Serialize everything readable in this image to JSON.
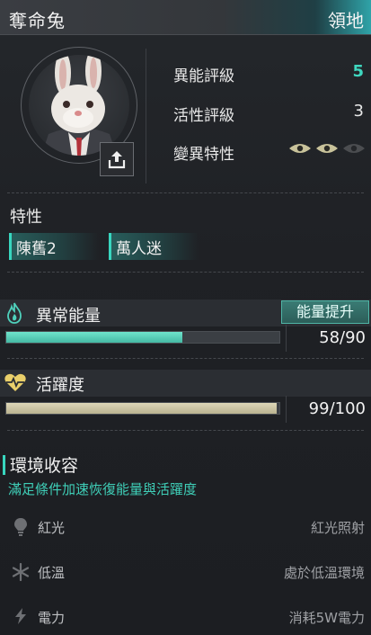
{
  "header": {
    "title": "奪命兔",
    "territory": "領地"
  },
  "ratings": [
    {
      "label": "異能評級",
      "value": "5",
      "color": "#3fd7bf"
    },
    {
      "label": "活性評級",
      "value": "3",
      "color": "#e8e8e8"
    },
    {
      "label": "變異特性",
      "eyes_active": 2,
      "eyes_total": 3
    }
  ],
  "traits": {
    "title": "特性",
    "items": [
      "陳舊2",
      "萬人迷"
    ]
  },
  "energy": {
    "label": "異常能量",
    "boost_label": "能量提升",
    "current": 58,
    "max": 90,
    "text": "58/90",
    "fill": 0.644,
    "color": "#5fd6bf"
  },
  "vigor": {
    "label": "活躍度",
    "current": 99,
    "max": 100,
    "text": "99/100",
    "fill": 0.99,
    "color": "#d6d0b0"
  },
  "environment": {
    "title": "環境收容",
    "subtitle": "滿足條件加速恢復能量與活躍度",
    "conditions": [
      {
        "icon": "lightbulb-icon",
        "label": "紅光",
        "status": "紅光照射"
      },
      {
        "icon": "snowflake-icon",
        "label": "低溫",
        "status": "處於低溫環境"
      },
      {
        "icon": "lightning-icon",
        "label": "電力",
        "status": "消耗5W電力"
      }
    ]
  }
}
